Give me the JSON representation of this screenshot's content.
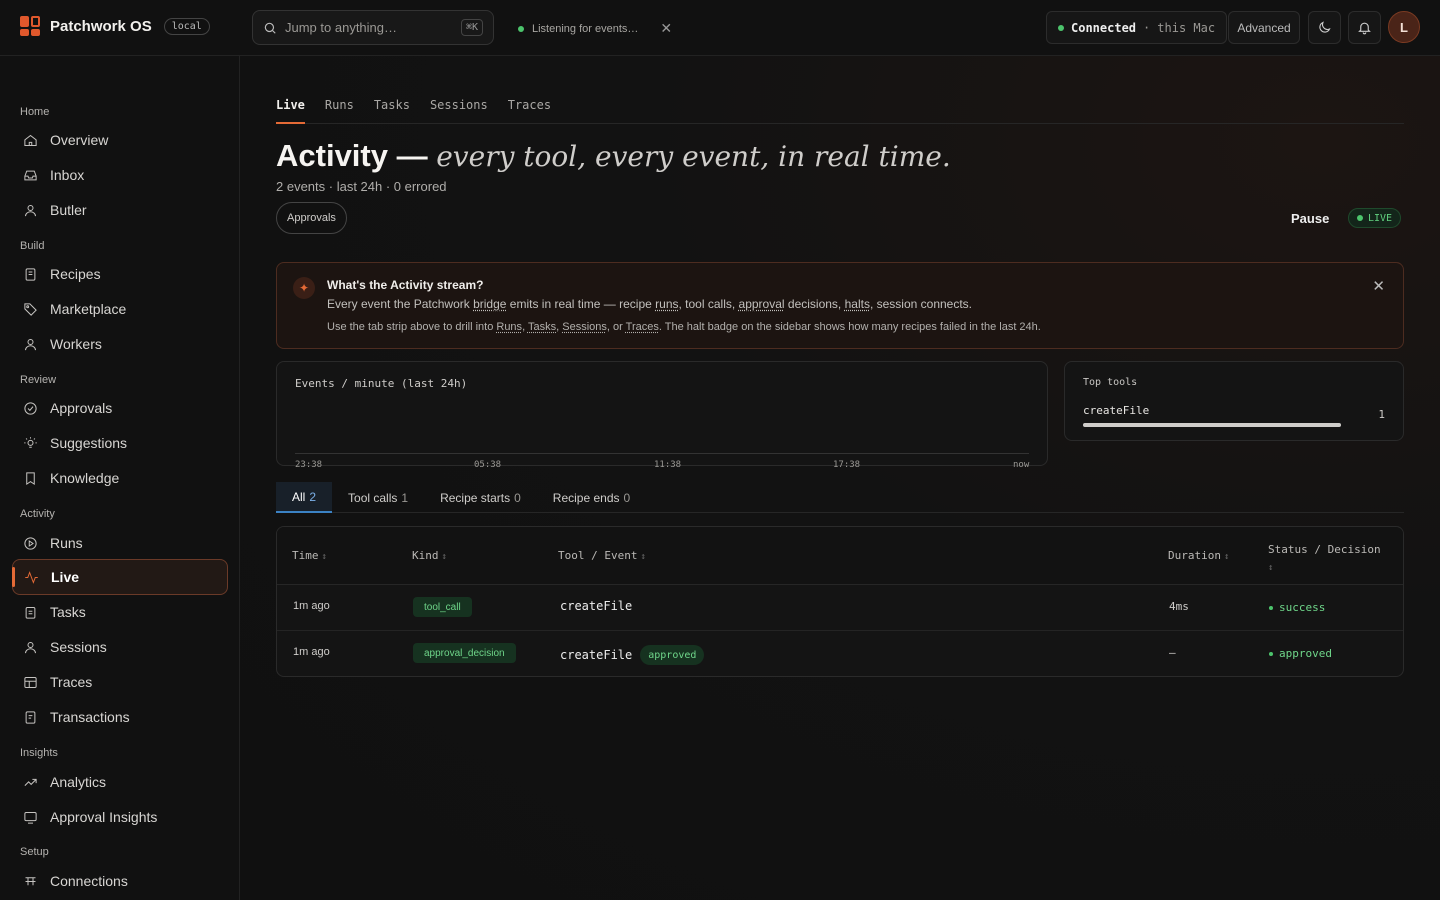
{
  "app": {
    "name": "Patchwork OS",
    "env_badge": "local"
  },
  "search": {
    "placeholder": "Jump to anything…",
    "shortcut": "⌘K"
  },
  "status_toast": {
    "text": "Listening for events…"
  },
  "connection": {
    "status": "Connected",
    "separator": "·",
    "target": "this Mac"
  },
  "header": {
    "advanced_label": "Advanced",
    "avatar_initial": "L"
  },
  "sidebar": {
    "sections": [
      {
        "label": "Home",
        "items": [
          "Overview",
          "Inbox",
          "Butler"
        ]
      },
      {
        "label": "Build",
        "items": [
          "Recipes",
          "Marketplace",
          "Workers"
        ]
      },
      {
        "label": "Review",
        "items": [
          "Approvals",
          "Suggestions",
          "Knowledge"
        ]
      },
      {
        "label": "Activity",
        "items": [
          "Runs",
          "Live",
          "Tasks",
          "Sessions",
          "Traces",
          "Transactions"
        ]
      },
      {
        "label": "Insights",
        "items": [
          "Analytics",
          "Approval Insights"
        ]
      },
      {
        "label": "Setup",
        "items": [
          "Connections"
        ]
      }
    ],
    "active_item": "Live"
  },
  "page": {
    "tabs": [
      "Live",
      "Runs",
      "Tasks",
      "Sessions",
      "Traces"
    ],
    "active_tab": "Live",
    "title": "Activity —",
    "title_tagline": "every tool, every event, in real time.",
    "summary": "2 events · last 24h · 0 errored",
    "approvals_pill": "Approvals",
    "pause_label": "Pause",
    "live_badge": "LIVE"
  },
  "info_banner": {
    "title": "What's the Activity stream?",
    "line1": {
      "p1": "Every event the Patchwork ",
      "bridge": "bridge",
      "p2": " emits in real time — recipe ",
      "runs": "runs",
      "p3": ", tool calls, ",
      "approval": "approval",
      "p4": " decisions, ",
      "halts": "halts",
      "p5": ", session connects."
    },
    "line2": {
      "p1": "Use the tab strip above to drill into ",
      "runs": "Runs",
      "c1": ", ",
      "tasks": "Tasks",
      "c2": ", ",
      "sessions": "Sessions",
      "c3": ", or ",
      "traces": "Traces",
      "p2": ". The halt badge on the sidebar shows how many recipes failed in the last 24h."
    }
  },
  "events_chart": {
    "title": "Events / minute (last 24h)",
    "ticks": [
      "23:38",
      "05:38",
      "11:38",
      "17:38",
      "now"
    ]
  },
  "top_tools": {
    "title": "Top tools",
    "items": [
      {
        "name": "createFile",
        "count": 1,
        "share": 1.0
      }
    ]
  },
  "filter_tabs": [
    {
      "label": "All",
      "count": "2"
    },
    {
      "label": "Tool calls",
      "count": "1"
    },
    {
      "label": "Recipe starts",
      "count": "0"
    },
    {
      "label": "Recipe ends",
      "count": "0"
    }
  ],
  "table": {
    "columns": [
      "Time",
      "Kind",
      "Tool / Event",
      "Duration",
      "Status / Decision"
    ],
    "rows": [
      {
        "time": "1m ago",
        "kind": "tool_call",
        "tool": "createFile",
        "tag": "",
        "duration": "4ms",
        "status": "success"
      },
      {
        "time": "1m ago",
        "kind": "approval_decision",
        "tool": "createFile",
        "tag": "approved",
        "duration": "—",
        "status": "approved"
      }
    ]
  },
  "colors": {
    "accent": "#e46a36",
    "success": "#6fd68a",
    "live": "#61d07f",
    "active_tab_blue": "#3b82c4"
  }
}
